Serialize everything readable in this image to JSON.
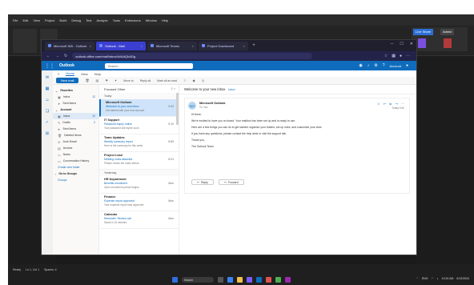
{
  "background_app": {
    "menu": [
      "File",
      "Edit",
      "View",
      "Project",
      "Build",
      "Debug",
      "Test",
      "Analyze",
      "Tools",
      "Extensions",
      "Window",
      "Help"
    ],
    "status_left": "Ready",
    "status_mid": "Ln 1, Col 1",
    "status_right": "Spaces: 4",
    "right_buttons": [
      "Live Share",
      "Admin"
    ]
  },
  "browser": {
    "tabs": [
      {
        "label": "Microsoft 365 - Outlook",
        "active": false
      },
      {
        "label": "Outlook - Mail",
        "active": true
      },
      {
        "label": "Microsoft Teams",
        "active": false
      },
      {
        "label": "Project Dashboard",
        "active": false
      }
    ],
    "url": "outlook.office.com/mail/inbox/id/AAQkADg",
    "window_controls": [
      "─",
      "☐",
      "✕"
    ],
    "nav": [
      "←",
      "→",
      "↻"
    ]
  },
  "outlook": {
    "brand": "Outlook",
    "search_placeholder": "Search",
    "account_label": "Account",
    "ribbon_tabs": [
      "Home",
      "View",
      "Help"
    ],
    "new_mail": "New mail",
    "toolbar_items": [
      "Delete",
      "Archive",
      "Report",
      "Sweep",
      "Move to",
      "Reply all",
      "Mark all as read",
      "Flag",
      "Categorize",
      "Snooze"
    ],
    "folders": [
      {
        "label": "Favorites",
        "type": "section"
      },
      {
        "label": "Inbox",
        "count": "12",
        "type": "folder"
      },
      {
        "label": "Sent Items",
        "count": "",
        "type": "folder"
      },
      {
        "label": "Account",
        "type": "section"
      },
      {
        "label": "Inbox",
        "count": "12",
        "type": "folder",
        "selected": true
      },
      {
        "label": "Drafts",
        "count": "2",
        "type": "folder"
      },
      {
        "label": "Sent Items",
        "count": "",
        "type": "folder"
      },
      {
        "label": "Deleted Items",
        "count": "",
        "type": "folder"
      },
      {
        "label": "Junk Email",
        "count": "",
        "type": "folder"
      },
      {
        "label": "Archive",
        "count": "",
        "type": "folder"
      },
      {
        "label": "Notes",
        "count": "",
        "type": "folder"
      },
      {
        "label": "Conversation History",
        "count": "",
        "type": "folder"
      },
      {
        "label": "Create new folder",
        "type": "link"
      },
      {
        "label": "Go to Groups",
        "type": "section"
      },
      {
        "label": "Groups",
        "type": "link"
      }
    ],
    "list_header": "Focused Other",
    "groups": [
      {
        "label": "Today",
        "mails": [
          {
            "from": "Microsoft Outlook",
            "subject": "Welcome to your new inbox",
            "time": "9:42",
            "preview": "Get started with your new account",
            "selected": true
          },
          {
            "from": "IT Support",
            "subject": "Password expiry notice",
            "time": "9:10",
            "preview": "Your password will expire soon"
          },
          {
            "from": "Team Updates",
            "subject": "Weekly summary report",
            "time": "8:55",
            "preview": "Here is the summary for this week"
          },
          {
            "from": "Project Lead",
            "subject": "Meeting notes attached",
            "time": "8:31",
            "preview": "Please review the notes before"
          }
        ]
      },
      {
        "label": "Yesterday",
        "mails": [
          {
            "from": "HR Department",
            "subject": "Benefits enrollment",
            "time": "Mon",
            "preview": "Open enrollment period begins"
          },
          {
            "from": "Finance",
            "subject": "Expense report approved",
            "time": "Mon",
            "preview": "Your expense report was approved"
          },
          {
            "from": "Calendar",
            "subject": "Reminder: Review call",
            "time": "Mon",
            "preview": "Starts in 15 minutes"
          }
        ]
      }
    ],
    "reading": {
      "subject": "Welcome to your new inbox",
      "tag": "Inbox",
      "sender_initials": "MO",
      "sender_name": "Microsoft Outlook",
      "to": "To: You",
      "date": "Today 9:42",
      "greeting": "Hi there,",
      "paragraphs": [
        "We're excited to have you on board. Your mailbox has been set up and is ready to use.",
        "Here are a few things you can do to get started: organize your folders, set up rules, and customize your view.",
        "If you have any questions, please contact the help desk or visit the support site.",
        "Thank you,",
        "The Outlook Team"
      ],
      "reply": "Reply",
      "forward": "Forward"
    }
  },
  "taskbar": {
    "search": "Search",
    "tray_time": "10:24 AM",
    "tray_date": "6/12/2024",
    "tray_items": [
      "ENG",
      "⌃"
    ]
  },
  "colors": {
    "outlook_blue": "#0f6cbd",
    "browser_tab_active": "#3b3fd1",
    "selected_mail": "#cfe4fa"
  }
}
